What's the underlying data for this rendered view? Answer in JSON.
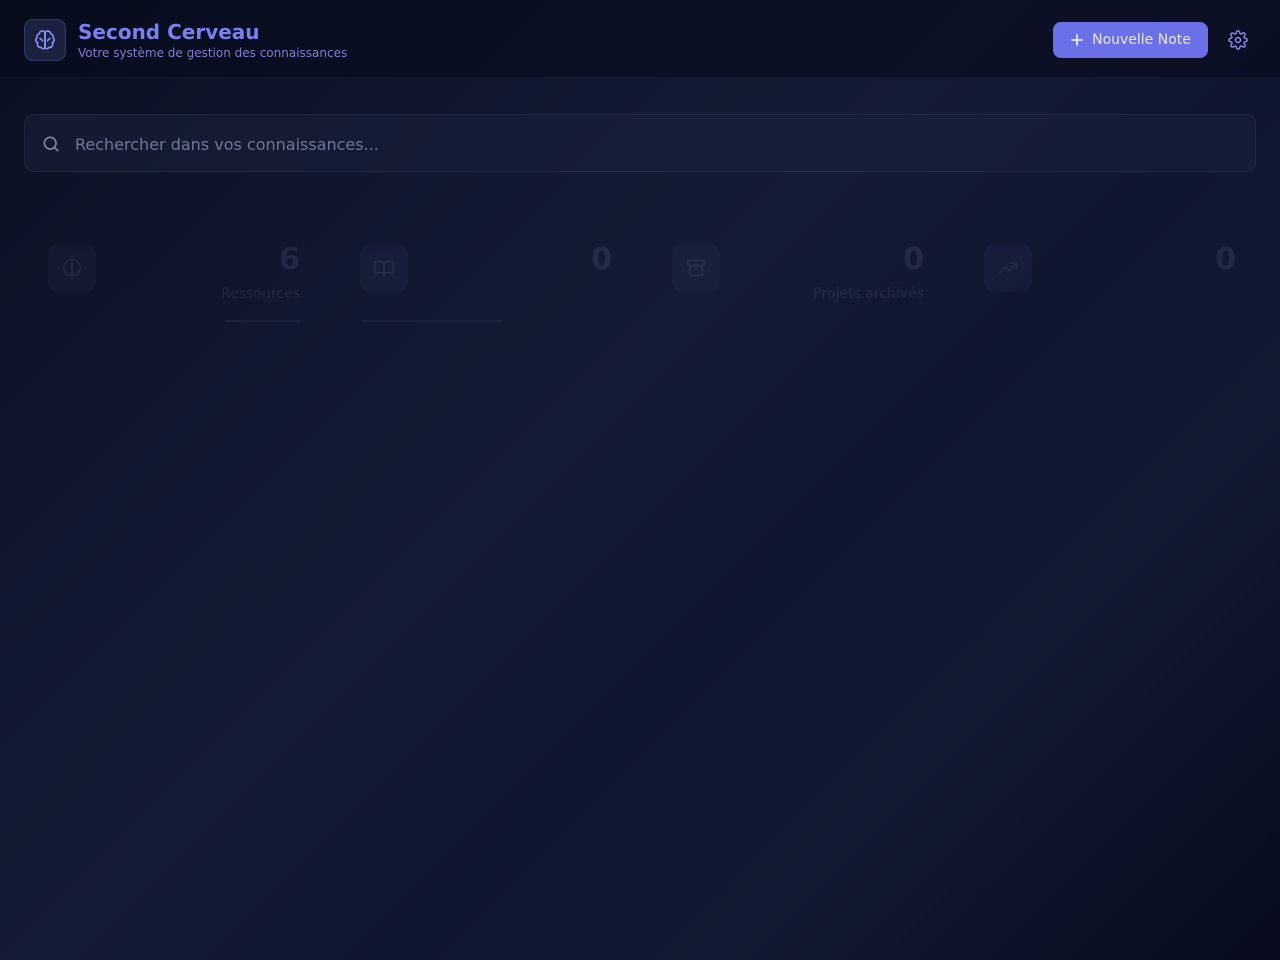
{
  "header": {
    "title": "Second Cerveau",
    "subtitle": "Votre système de gestion des connaissances",
    "logo_icon": "brain-icon",
    "new_note_label": "Nouvelle Note",
    "settings_icon": "gear-icon"
  },
  "search": {
    "placeholder": "Rechercher dans vos connaissances...",
    "value": ""
  },
  "stats": [
    {
      "value": "6",
      "label": "Ressources",
      "icon": "brain-icon"
    },
    {
      "value": "0",
      "label": "",
      "icon": "book-icon"
    },
    {
      "value": "0",
      "label": "Projets archivés",
      "icon": "archive-icon"
    },
    {
      "value": "0",
      "label": "",
      "icon": "trend-icon"
    }
  ],
  "colors": {
    "accent": "#6b6fe8",
    "title": "#7b7ff0",
    "background": "#0f1630"
  }
}
